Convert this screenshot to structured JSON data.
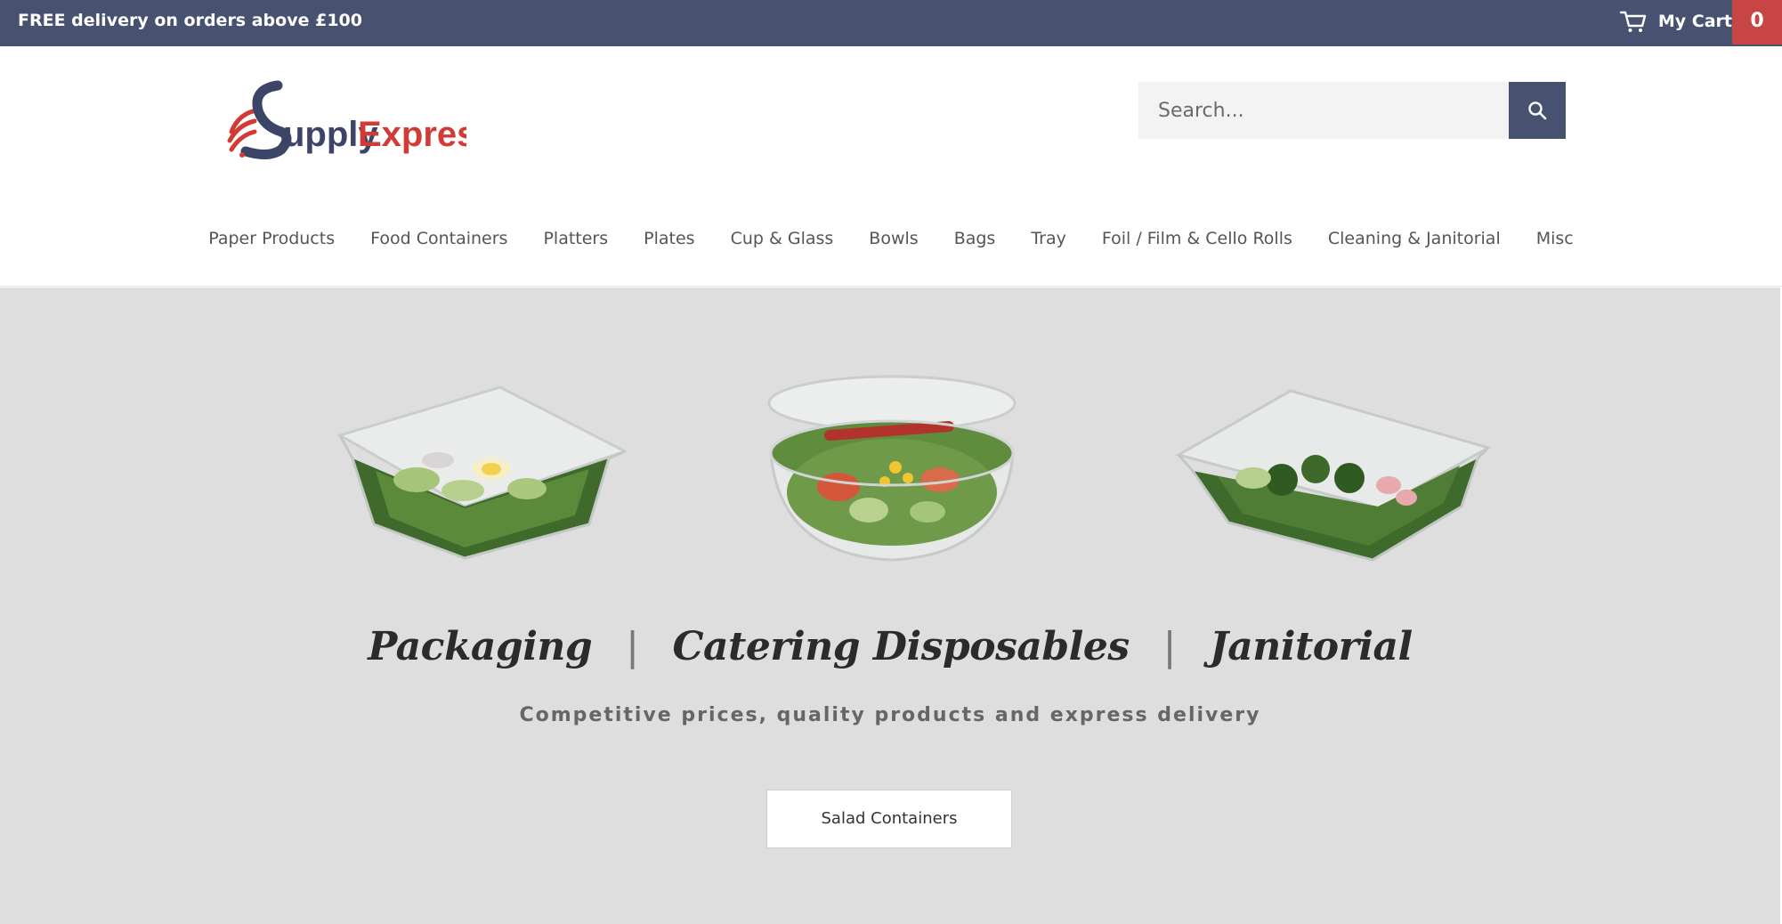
{
  "topbar": {
    "promo": "FREE delivery on orders above £100",
    "cart_label": "My Cart",
    "cart_count": "0",
    "cart_icon": "cart-icon"
  },
  "header": {
    "logo_text_supply": "upply",
    "logo_text_express": "Express",
    "logo_letter": "S",
    "search_placeholder": "Search...",
    "search_icon": "search-icon"
  },
  "nav": {
    "items": [
      "Paper Products",
      "Food Containers",
      "Platters",
      "Plates",
      "Cup & Glass",
      "Bowls",
      "Bags",
      "Tray",
      "Foil / Film & Cello Rolls",
      "Cleaning & Janitorial",
      "Misc"
    ]
  },
  "hero": {
    "headline_1": "Packaging",
    "headline_2": "Catering Disposables",
    "headline_3": "Janitorial",
    "separator": "|",
    "tagline": "Competitive prices, quality products and express delivery",
    "cta_label": "Salad Containers"
  },
  "colors": {
    "topbar": "#475170",
    "cart_badge": "#c74543",
    "hero_bg": "#dedede",
    "logo_blue": "#3c4467",
    "logo_red": "#d23a35"
  }
}
